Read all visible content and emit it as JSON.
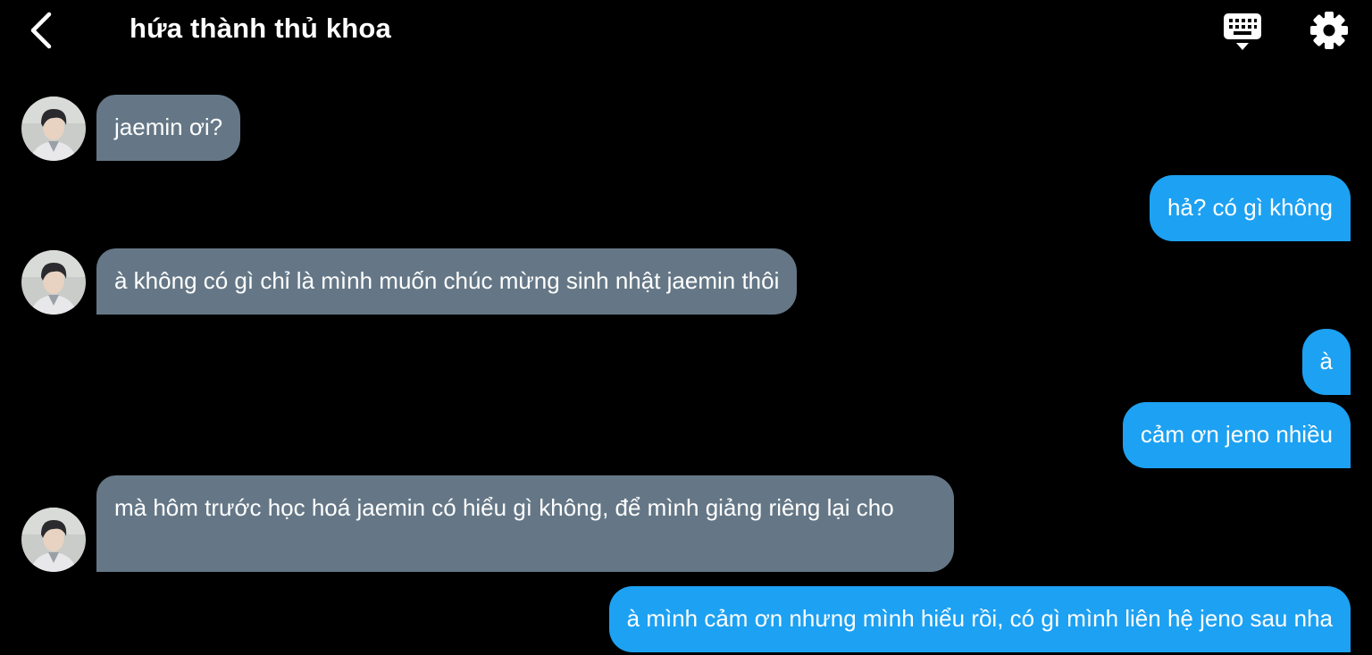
{
  "header": {
    "title": "hứa thành thủ khoa",
    "back_icon": "chevron-left-icon",
    "keyboard_icon": "keyboard-icon",
    "settings_icon": "gear-icon"
  },
  "colors": {
    "background": "#000000",
    "incoming_bubble": "#657786",
    "outgoing_bubble": "#1da1f2",
    "text": "#ffffff"
  },
  "messages": [
    {
      "side": "in",
      "text": "jaemin ơi?"
    },
    {
      "side": "out",
      "text": "hả? có gì không"
    },
    {
      "side": "in",
      "text": "à không có gì chỉ là mình muốn chúc mừng sinh nhật jaemin thôi"
    },
    {
      "side": "out",
      "text": "à"
    },
    {
      "side": "out",
      "text": "cảm ơn jeno nhiều"
    },
    {
      "side": "in",
      "text": "mà hôm trước học hoá jaemin có hiểu gì không, để mình giảng riêng lại cho"
    },
    {
      "side": "out",
      "text": "à mình cảm ơn nhưng mình hiểu rồi, có gì mình liên hệ jeno sau nha"
    }
  ]
}
